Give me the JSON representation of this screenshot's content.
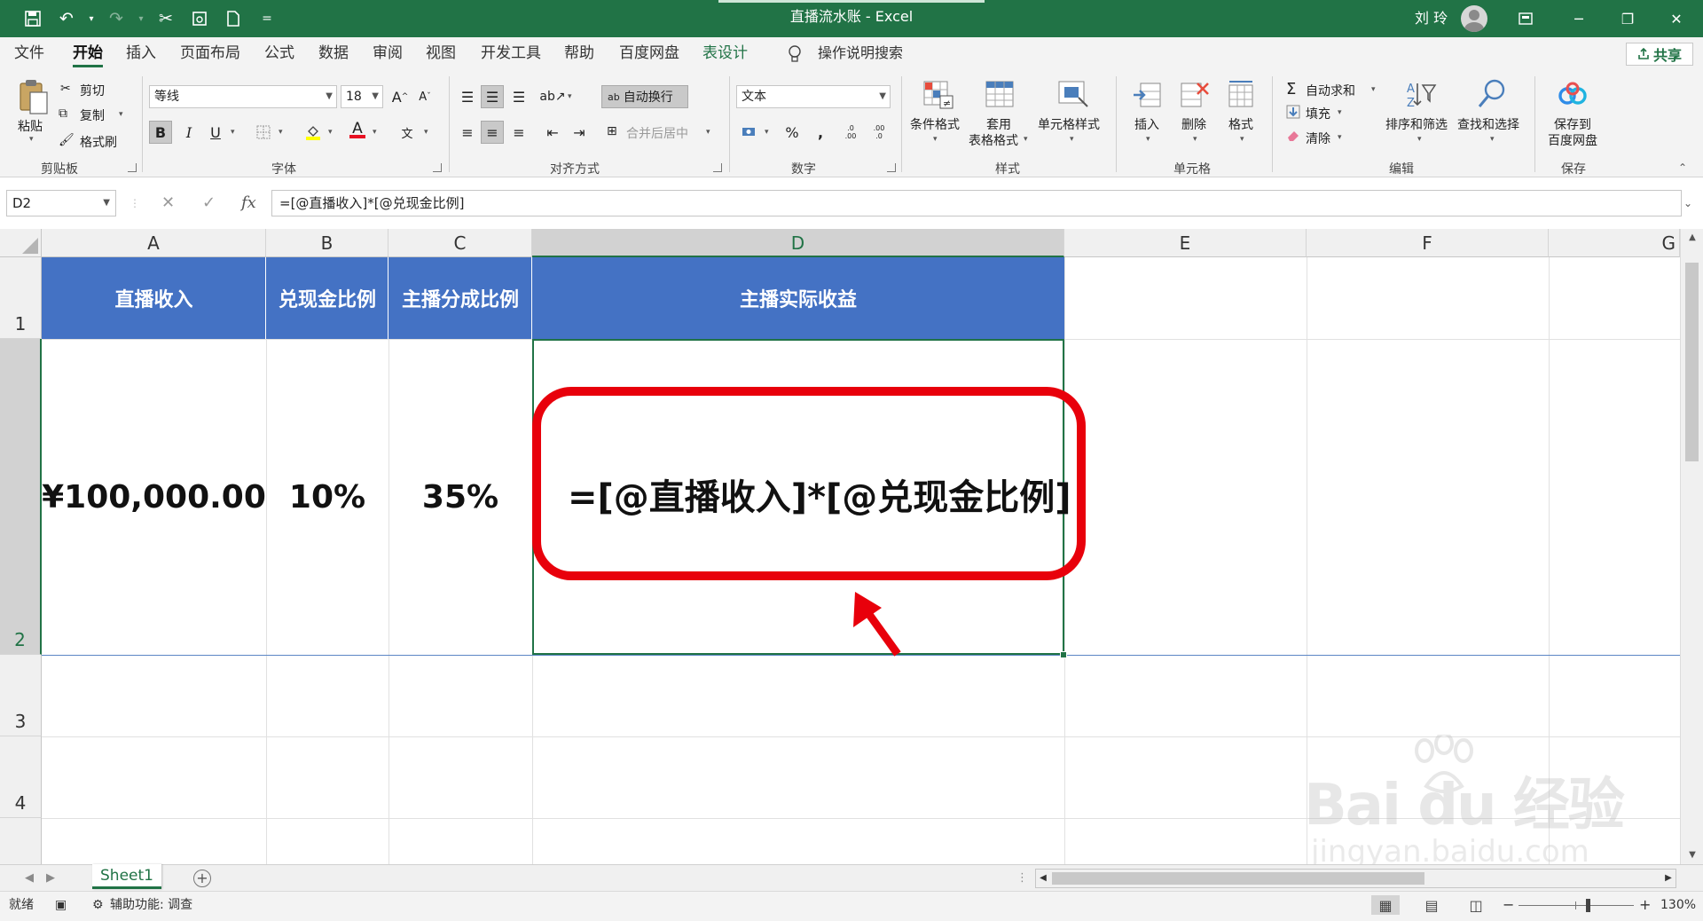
{
  "window": {
    "title": "直播流水账 - Excel",
    "user_name": "刘 玲",
    "qat_more": "="
  },
  "tabs": [
    "文件",
    "开始",
    "插入",
    "页面布局",
    "公式",
    "数据",
    "审阅",
    "视图",
    "开发工具",
    "帮助",
    "百度网盘",
    "表设计"
  ],
  "active_tab": "开始",
  "search_placeholder": "操作说明搜索",
  "share_label": "共享",
  "ribbon": {
    "clipboard": {
      "paste": "粘贴",
      "cut": "剪切",
      "copy": "复制",
      "format_painter": "格式刷",
      "label": "剪贴板"
    },
    "font": {
      "name": "等线",
      "size": "18",
      "bold": "B",
      "italic": "I",
      "underline": "U",
      "label": "字体",
      "grow": "A",
      "shrink": "A",
      "font_color_glyph": "A",
      "phonetic": "文"
    },
    "alignment": {
      "wrap_text": "自动换行",
      "merge_center": "合并后居中",
      "label": "对齐方式",
      "wrap_glyph": "ab"
    },
    "number": {
      "format": "文本",
      "percent": "%",
      "comma": ",",
      "label": "数字",
      "inc_decimal": ".0\n.00",
      "dec_decimal": ".00\n.0"
    },
    "styles": {
      "conditional": "条件格式",
      "table_format_1": "套用",
      "table_format_2": "表格格式",
      "cell_styles": "单元格样式",
      "label": "样式"
    },
    "cells": {
      "insert": "插入",
      "delete": "删除",
      "format": "格式",
      "label": "单元格"
    },
    "editing": {
      "autosum": "自动求和",
      "fill": "填充",
      "clear": "清除",
      "sort_filter": "排序和筛选",
      "find_select": "查找和选择",
      "label": "编辑",
      "sigma": "Σ"
    },
    "save": {
      "line1": "保存到",
      "line2": "百度网盘",
      "label": "保存"
    }
  },
  "formula_bar": {
    "name_box": "D2",
    "cancel": "✕",
    "enter": "✓",
    "fx": "fx",
    "formula": "=[@直播收入]*[@兑现金比例]"
  },
  "columns": [
    "A",
    "B",
    "C",
    "D",
    "E",
    "F",
    "G"
  ],
  "rows": [
    "1",
    "2",
    "3",
    "4"
  ],
  "table": {
    "headers": [
      "直播收入",
      "兑现金比例",
      "主播分成比例",
      "主播实际收益"
    ],
    "row": [
      "¥100,000.00",
      "10%",
      "35%",
      "=[@直播收入]*[@兑现金比例]"
    ]
  },
  "sheet_tabs": [
    "Sheet1"
  ],
  "add_sheet": "+",
  "status": {
    "mode": "就绪",
    "accessibility": "辅助功能: 调查",
    "zoom": "130%",
    "zoom_minus": "−",
    "zoom_plus": "+",
    "zoom_fraction": 0.6
  },
  "watermark": {
    "logo": "Bai du 经验",
    "url": "jingyan.baidu.com"
  },
  "colors": {
    "excel_green": "#217346",
    "table_header": "#4472c4",
    "highlight_red": "#e8000b"
  }
}
